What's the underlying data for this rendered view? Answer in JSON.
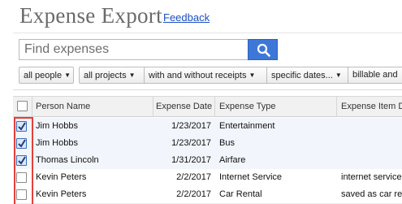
{
  "header": {
    "title": "Expense Export",
    "feedback_label": "Feedback"
  },
  "search": {
    "placeholder": "Find expenses",
    "icon": "search-icon"
  },
  "filters": [
    {
      "label": "all people"
    },
    {
      "label": "all projects"
    },
    {
      "label": "with and without receipts"
    },
    {
      "label": "specific dates..."
    },
    {
      "label": "billable and"
    }
  ],
  "table": {
    "columns": [
      "Person Name",
      "Expense Date",
      "Expense Type",
      "Expense Item D"
    ],
    "rows": [
      {
        "checked": true,
        "person": "Jim Hobbs",
        "date": "1/23/2017",
        "type": "Entertainment",
        "item": ""
      },
      {
        "checked": true,
        "person": "Jim Hobbs",
        "date": "1/23/2017",
        "type": "Bus",
        "item": ""
      },
      {
        "checked": true,
        "person": "Thomas Lincoln",
        "date": "1/31/2017",
        "type": "Airfare",
        "item": ""
      },
      {
        "checked": false,
        "person": "Kevin Peters",
        "date": "2/2/2017",
        "type": "Internet Service",
        "item": "internet service"
      },
      {
        "checked": false,
        "person": "Kevin Peters",
        "date": "2/2/2017",
        "type": "Car Rental",
        "item": "saved as car rer"
      }
    ]
  },
  "colors": {
    "accent": "#3d78d8",
    "link": "#1a4fc4",
    "highlight": "#e4403a"
  }
}
